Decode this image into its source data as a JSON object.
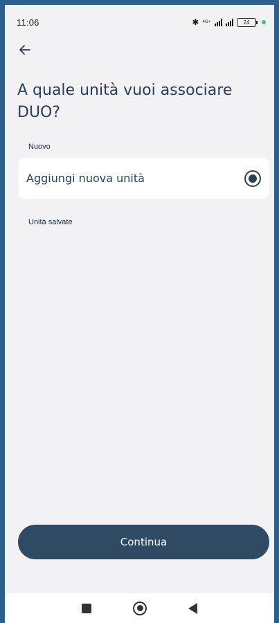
{
  "status_bar": {
    "time": "11:06",
    "network_label": "4G+",
    "battery_level": "24",
    "bluetooth_icon": "bluetooth-icon",
    "indicator_color": "#2ecc71"
  },
  "header": {
    "back_icon": "arrow-left-icon",
    "title": "A quale unità vuoi associare DUO?"
  },
  "sections": {
    "new_label": "Nuovo",
    "saved_label": "Unità salvate"
  },
  "new_unit_option": {
    "label": "Aggiungi nuova unità",
    "selected": true
  },
  "actions": {
    "continue_label": "Continua"
  },
  "nav_bar": {
    "items": [
      "recents-icon",
      "home-icon",
      "back-icon"
    ]
  },
  "colors": {
    "primary": "#2b3e55",
    "button": "#2f4a63",
    "background": "#f2f2f5",
    "frame": "#2c5f8e"
  }
}
